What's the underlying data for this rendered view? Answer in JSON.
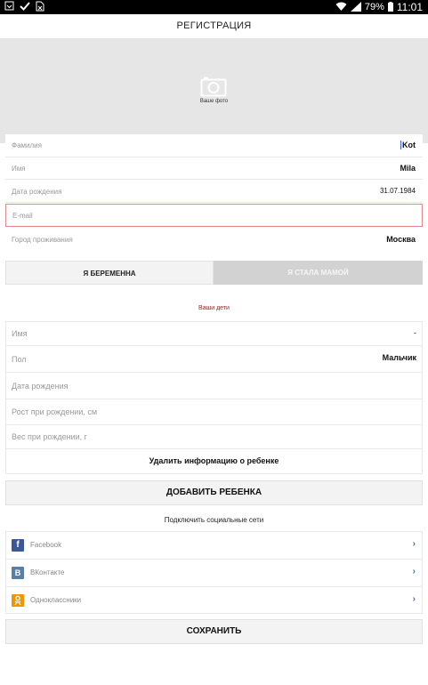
{
  "status_bar": {
    "battery": "79%",
    "time": "11:01"
  },
  "header": {
    "title": "РЕГИСТРАЦИЯ"
  },
  "photo": {
    "label": "Ваше фото"
  },
  "form": {
    "fields": [
      {
        "label": "Фамилия",
        "value": "Kot"
      },
      {
        "label": "Имя",
        "value": "Mila"
      },
      {
        "label": "Дата рождения",
        "value": "31.07.1984"
      },
      {
        "label": "E-mail",
        "value": ""
      },
      {
        "label": "Город проживания",
        "value": "Москва"
      }
    ]
  },
  "status_toggle": {
    "option1": "Я БЕРЕМЕННА",
    "option2": "Я СТАЛА МАМОЙ"
  },
  "kids": {
    "title": "Ваши дети",
    "fields": [
      {
        "label": "Имя",
        "value": "-"
      },
      {
        "label": "Пол",
        "value": "Мальчик"
      },
      {
        "label": "Дата рождения",
        "value": ""
      },
      {
        "label": "Рост при рождении, см",
        "value": ""
      },
      {
        "label": "Вес при рождении, г",
        "value": ""
      }
    ],
    "delete_label": "Удалить информацию о ребенке"
  },
  "add_child_label": "ДОБАВИТЬ РЕБЕНКА",
  "social": {
    "title": "Подключить социальные сети",
    "items": [
      {
        "label": "Facebook",
        "icon": "facebook-icon",
        "color": "#3b5998"
      },
      {
        "label": "ВКонтакте",
        "icon": "vk-icon",
        "color": "#5a7fa6"
      },
      {
        "label": "Одноклассники",
        "icon": "odnoklassniki-icon",
        "color": "#f29400"
      }
    ]
  },
  "save_label": "СОХРАНИТЬ"
}
